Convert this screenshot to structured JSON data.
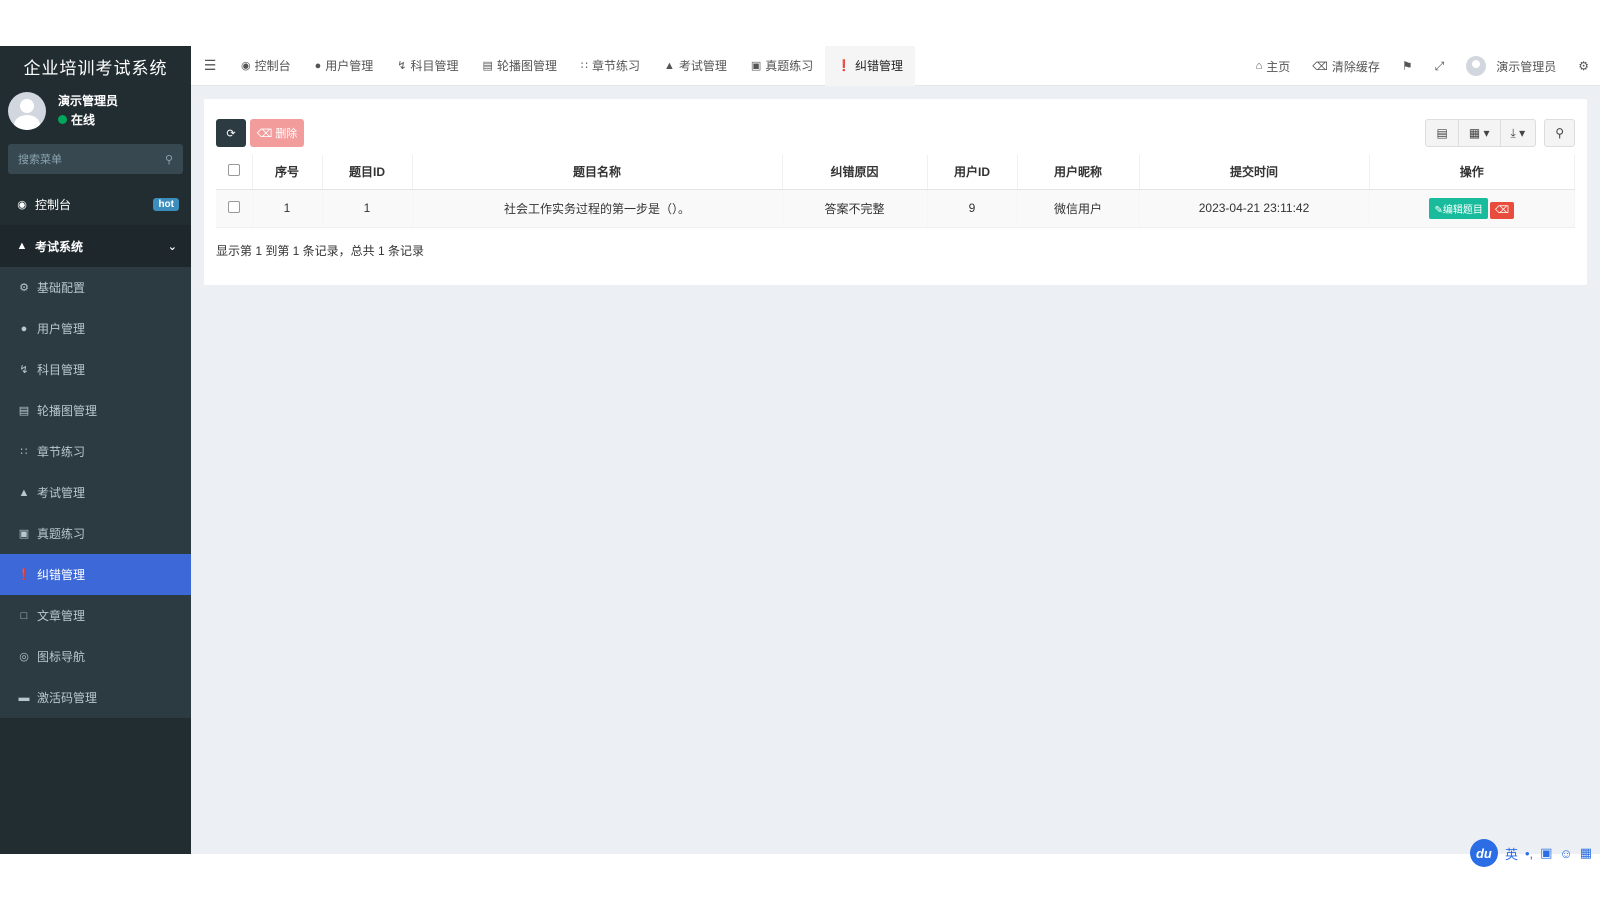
{
  "app": {
    "title": "企业培训考试系统"
  },
  "user": {
    "name": "演示管理员",
    "status": "在线"
  },
  "sidebar": {
    "search_placeholder": "搜索菜单",
    "dashboard": {
      "label": "控制台",
      "badge": "hot"
    },
    "group": {
      "label": "考试系统"
    },
    "items": [
      {
        "label": "基础配置",
        "icon": "gear-icon"
      },
      {
        "label": "用户管理",
        "icon": "user-icon"
      },
      {
        "label": "科目管理",
        "icon": "bolt-icon"
      },
      {
        "label": "轮播图管理",
        "icon": "image-icon"
      },
      {
        "label": "章节练习",
        "icon": "list-icon"
      },
      {
        "label": "考试管理",
        "icon": "graduation-cap-icon"
      },
      {
        "label": "真题练习",
        "icon": "table-icon"
      },
      {
        "label": "纠错管理",
        "icon": "exclamation-circle-icon",
        "active": true
      },
      {
        "label": "文章管理",
        "icon": "file-icon"
      },
      {
        "label": "图标导航",
        "icon": "compass-icon"
      },
      {
        "label": "激活码管理",
        "icon": "card-icon"
      }
    ]
  },
  "navbar": {
    "tabs": [
      {
        "label": "控制台",
        "icon": "dashboard-icon"
      },
      {
        "label": "用户管理",
        "icon": "user-icon"
      },
      {
        "label": "科目管理",
        "icon": "bolt-icon"
      },
      {
        "label": "轮播图管理",
        "icon": "image-icon"
      },
      {
        "label": "章节练习",
        "icon": "list-icon"
      },
      {
        "label": "考试管理",
        "icon": "graduation-cap-icon"
      },
      {
        "label": "真题练习",
        "icon": "table-icon"
      },
      {
        "label": "纠错管理",
        "icon": "exclamation-circle-icon",
        "active": true
      }
    ],
    "home": "主页",
    "clear_cache": "清除缓存",
    "admin_name": "演示管理员"
  },
  "toolbar": {
    "delete_label": "删除"
  },
  "table": {
    "headers": [
      "序号",
      "题目ID",
      "题目名称",
      "纠错原因",
      "用户ID",
      "用户昵称",
      "提交时间",
      "操作"
    ],
    "rows": [
      {
        "index": "1",
        "question_id": "1",
        "question_name": "社会工作实务过程的第一步是（）。",
        "reason": "答案不完整",
        "user_id": "9",
        "nickname": "微信用户",
        "submitted_at": "2023-04-21 23:11:42",
        "edit_label": "编辑题目"
      }
    ],
    "pagination_info": "显示第 1 到第 1 条记录，总共 1 条记录"
  },
  "ime": {
    "logo": "du",
    "lang": "英"
  }
}
